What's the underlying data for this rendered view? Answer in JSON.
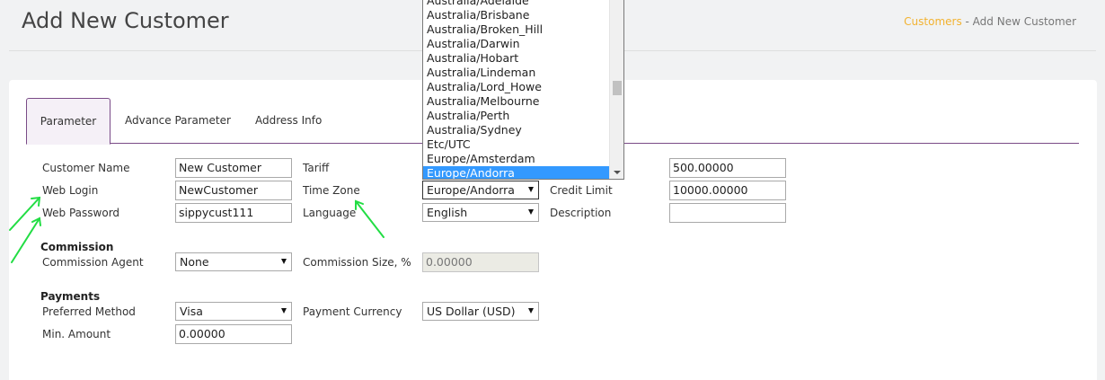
{
  "header": {
    "title": "Add New Customer",
    "breadcrumb": {
      "link": "Customers",
      "separator": " - ",
      "current": "Add New Customer"
    }
  },
  "tabs": [
    "Parameter",
    "Advance Parameter",
    "Address Info"
  ],
  "form": {
    "customer_name": {
      "label": "Customer Name",
      "value": "New Customer"
    },
    "web_login": {
      "label": "Web Login",
      "value": "NewCustomer"
    },
    "web_password": {
      "label": "Web Password",
      "value": "sippycust111"
    },
    "tariff": {
      "label": "Tariff"
    },
    "time_zone": {
      "label": "Time Zone",
      "value": "Europe/Andorra"
    },
    "language": {
      "label": "Language",
      "value": "English"
    },
    "balance": {
      "value": "500.00000"
    },
    "credit_limit": {
      "label": "Credit Limit",
      "value": "10000.00000"
    },
    "description": {
      "label": "Description",
      "value": ""
    }
  },
  "commission": {
    "heading": "Commission",
    "agent": {
      "label": "Commission Agent",
      "value": "None"
    },
    "size": {
      "label": "Commission Size, %",
      "value": "0.00000"
    }
  },
  "payments": {
    "heading": "Payments",
    "method": {
      "label": "Preferred Method",
      "value": "Visa"
    },
    "currency": {
      "label": "Payment Currency",
      "value": "US Dollar (USD)"
    },
    "min_amount": {
      "label": "Min. Amount",
      "value": "0.00000"
    }
  },
  "timezone_dropdown": {
    "options": [
      "Australia/Adelaide",
      "Australia/Brisbane",
      "Australia/Broken_Hill",
      "Australia/Darwin",
      "Australia/Hobart",
      "Australia/Lindeman",
      "Australia/Lord_Howe",
      "Australia/Melbourne",
      "Australia/Perth",
      "Australia/Sydney",
      "Etc/UTC",
      "Europe/Amsterdam",
      "Europe/Andorra"
    ],
    "selected": "Europe/Andorra"
  },
  "colors": {
    "accent": "#7a4b87",
    "breadcrumb_link": "#f2b230",
    "annotation_arrow": "#22dd44",
    "selection": "#3399ff"
  }
}
